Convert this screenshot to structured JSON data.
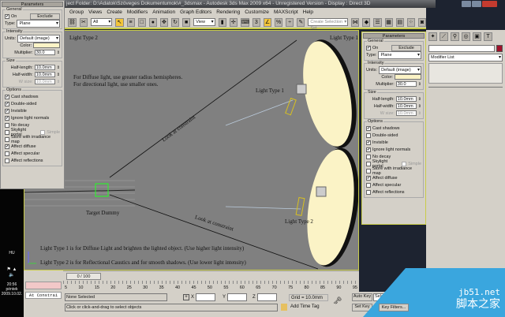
{
  "window": {
    "title": "ject Folder: D:\\Adatok\\Szöveges Dokumentumok\\#_3dsmax   - Autodesk 3ds Max  2009 x64  - Unregistered Version   - Display : Direct 3D"
  },
  "menu": [
    "Group",
    "Views",
    "Create",
    "Modifiers",
    "Animation",
    "Graph Editors",
    "Rendering",
    "Customize",
    "MAXScript",
    "Help"
  ],
  "toolbar": {
    "filter": "All",
    "ref_coord": "View",
    "selection_set_placeholder": "Create Selection Set"
  },
  "params": {
    "header": "Parameters",
    "general": "General",
    "on_label": "On",
    "on": true,
    "exclude": "Exclude",
    "type_label": "Type:",
    "type": "Plane",
    "intensity": "Intensity",
    "units_label": "Units:",
    "units": "Default (image)",
    "color_label": "Color:",
    "color": "#fbf3c6",
    "multiplier_label": "Multiplier:",
    "multiplier": "30.0",
    "size": "Size",
    "half_length_label": "Half-length:",
    "half_length": "10.0mm",
    "half_width_label": "Half-width:",
    "half_width": "10.0mm",
    "w_size_label": "W size:",
    "w_size": "10.0mm",
    "options": "Options",
    "simple": "Simple"
  },
  "left_options": [
    {
      "label": "Cast shadows",
      "checked": true
    },
    {
      "label": "Double-sided",
      "checked": true
    },
    {
      "label": "Invisible",
      "checked": true
    },
    {
      "label": "Ignore light normals",
      "checked": true
    },
    {
      "label": "No decay",
      "checked": false
    },
    {
      "label": "Skylight portal",
      "checked": false
    },
    {
      "label": "Store with irradiance map",
      "checked": false
    },
    {
      "label": "Affect diffuse",
      "checked": true
    },
    {
      "label": "Affect specular",
      "checked": false
    },
    {
      "label": "Affect reflections",
      "checked": false
    }
  ],
  "right_options": [
    {
      "label": "Cast shadows",
      "checked": true
    },
    {
      "label": "Double-sided",
      "checked": false
    },
    {
      "label": "Invisible",
      "checked": true
    },
    {
      "label": "Ignore light normals",
      "checked": true
    },
    {
      "label": "No decay",
      "checked": false
    },
    {
      "label": "Skylight portal",
      "checked": false
    },
    {
      "label": "Store with irradiance map",
      "checked": false
    },
    {
      "label": "Affect diffuse",
      "checked": true
    },
    {
      "label": "Affect specular",
      "checked": false
    },
    {
      "label": "Affect reflections",
      "checked": false
    }
  ],
  "viewport": {
    "label_tl": "Light Type 2",
    "label_tr": "Light Type 1",
    "note1": "For Diffuse light, use greater radius hemispheres.",
    "note2": "For directional light, use smaller ones.",
    "light1": "Light Type 1",
    "light2": "Light Type 2",
    "dummy": "Target Dummy",
    "constraint1": "Look at constraint",
    "constraint2": "Look at constraint",
    "legend1": "Light Type 1 is for Diffuse Light and brighten the lighted object. (Use higher light intensity)",
    "legend2": "Light Type 2 is for Reflectional Caustics and for smooth shadows. (Use lower light intensity)"
  },
  "command_panel": {
    "modifier_list": "Modifier List",
    "object_color": "#a0102a"
  },
  "timeline": {
    "frame": "0 / 100",
    "ticks": [
      "5",
      "10",
      "15",
      "20",
      "25",
      "30",
      "35",
      "40",
      "45",
      "50",
      "55",
      "60",
      "65",
      "70",
      "75",
      "80",
      "85",
      "90",
      "95"
    ]
  },
  "status": {
    "selection": "None Selected",
    "prompt": "Click or click-and-drag to select objects",
    "x_label": "X",
    "y_label": "Y",
    "z_label": "Z",
    "grid": "Grid = 10.0mm",
    "add_time_tag": "Add Time Tag",
    "auto_key": "Auto Key",
    "selected": "Selected",
    "set_key": "Set Key",
    "key_filters": "Key Filters...",
    "maxscript": "At Constrai"
  },
  "taskbar": {
    "lang": "HU",
    "time": "20:56",
    "day": "péntek",
    "date": "2009.10.02."
  },
  "watermark": {
    "site": "jb51.net",
    "name": "脚本之家"
  }
}
